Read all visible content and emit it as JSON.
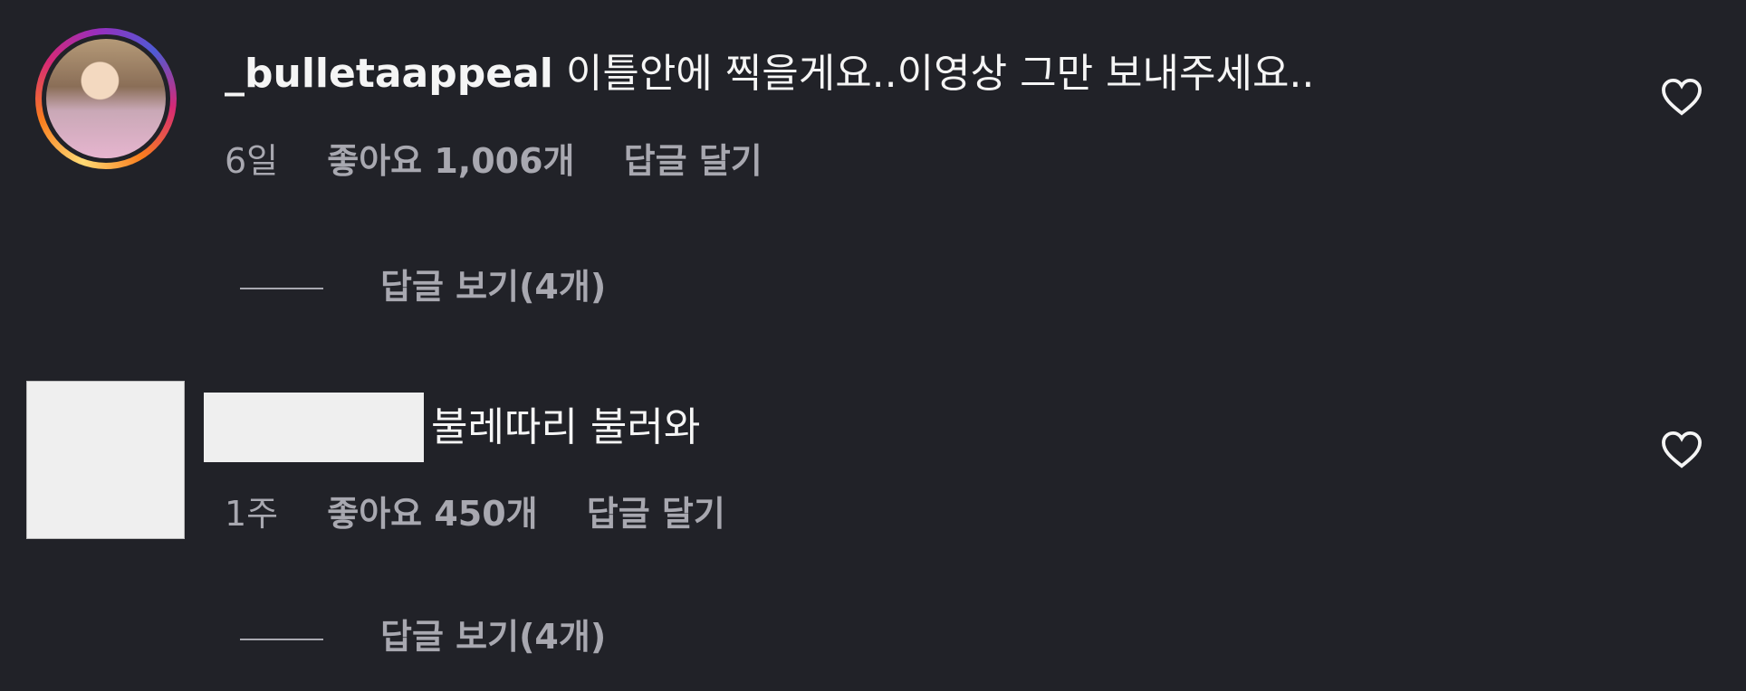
{
  "comments": [
    {
      "username": "_bulletaappeal",
      "text": "이틀안에 찍을게요..이영상 그만 보내주세요..",
      "time": "6일",
      "likes": "좋아요 1,006개",
      "reply_label": "답글 달기",
      "view_replies": "답글 보기(4개)"
    },
    {
      "username": "",
      "text": "불레따리 불러와",
      "time": "1주",
      "likes": "좋아요 450개",
      "reply_label": "답글 달기",
      "view_replies": "답글 보기(4개)"
    }
  ],
  "icons": {
    "like": "heart-outline-icon"
  },
  "colors": {
    "background": "#212228",
    "text": "#f5f5f5",
    "meta": "#a8a8b0",
    "redaction": "#efefef"
  }
}
